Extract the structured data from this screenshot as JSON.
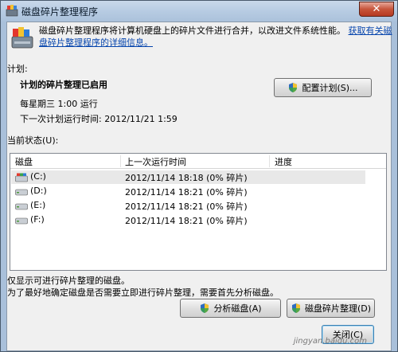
{
  "window": {
    "title": "磁盘碎片整理程序",
    "close_label": "✕"
  },
  "header": {
    "description": "磁盘碎片整理程序将计算机硬盘上的碎片文件进行合并，以改进文件系统性能。",
    "link": "获取有关磁盘碎片整理程序的详细信息。"
  },
  "schedule": {
    "group_label": "计划:",
    "status": "计划的碎片整理已启用",
    "frequency": "每星期三  1:00 运行",
    "next_run": "下一次计划运行时间: 2012/11/21 1:59",
    "configure_button": "配置计划(S)..."
  },
  "current_status": {
    "group_label": "当前状态(U):",
    "columns": [
      "磁盘",
      "上一次运行时间",
      "进度"
    ],
    "rows": [
      {
        "disk": "(C:)",
        "last_run": "2012/11/14 18:18 (0% 碎片)",
        "progress": ""
      },
      {
        "disk": "(D:)",
        "last_run": "2012/11/14 18:21 (0% 碎片)",
        "progress": ""
      },
      {
        "disk": "(E:)",
        "last_run": "2012/11/14 18:21 (0% 碎片)",
        "progress": ""
      },
      {
        "disk": "(F:)",
        "last_run": "2012/11/14 18:21 (0% 碎片)",
        "progress": ""
      }
    ]
  },
  "notes": {
    "line1": "仅显示可进行碎片整理的磁盘。",
    "line2": "为了最好地确定磁盘是否需要立即进行碎片整理，需要首先分析磁盘。"
  },
  "buttons": {
    "analyze": "分析磁盘(A)",
    "defrag": "磁盘碎片整理(D)",
    "close": "关闭(C)"
  },
  "watermark": "jingyan.baidu.com",
  "colors": {
    "link": "#0645ad",
    "close_button": "#c7553b",
    "title_bar": "#b6cbe2"
  }
}
